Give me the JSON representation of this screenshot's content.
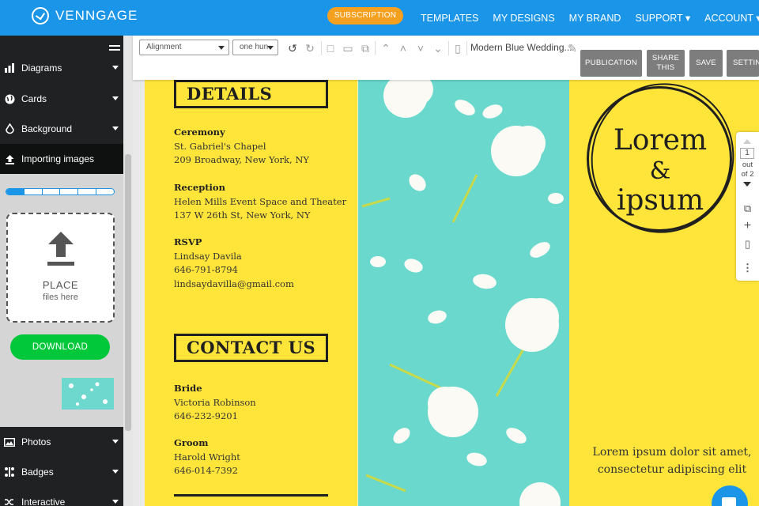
{
  "brand": {
    "name": "VENNGAGE"
  },
  "topnav": {
    "subscription": "SUBSCRIPTION",
    "links": [
      "TEMPLATES",
      "MY DESIGNS",
      "MY BRAND",
      "SUPPORT ▾",
      "ACCOUNT ▾"
    ]
  },
  "sidebar": {
    "items": [
      {
        "label": "Diagrams",
        "icon": "bar-chart-icon"
      },
      {
        "label": "Cards",
        "icon": "globe-icon"
      },
      {
        "label": "Background",
        "icon": "drop-icon"
      },
      {
        "label": "Importing images",
        "icon": "upload-icon"
      },
      {
        "label": "Photos",
        "icon": "image-icon"
      },
      {
        "label": "Badges",
        "icon": "badge-icon"
      },
      {
        "label": "Interactive",
        "icon": "shuffle-icon"
      }
    ],
    "upload": {
      "title": "PLACE",
      "subtitle": "files here"
    },
    "upload_progress_segments_filled": 1,
    "upload_progress_segments_total": 6,
    "download": "DOWNLOAD"
  },
  "toolbar": {
    "alignment": "Alignment",
    "size": "one hun",
    "doc_title": "Modern Blue Wedding...",
    "buttons": {
      "publication": "PUBLICATION",
      "share": "SHARE THIS",
      "save": "SAVE",
      "settings": "SETTIN"
    }
  },
  "flyer": {
    "details_title": "DETAILS",
    "ceremony": {
      "label": "Ceremony",
      "line1": "St. Gabriel's Chapel",
      "line2": "209 Broadway, New York, NY"
    },
    "reception": {
      "label": "Reception",
      "line1": "Helen Mills Event Space and Theater",
      "line2": "137 W 26th St, New York, NY"
    },
    "rsvp": {
      "label": "RSVP",
      "line1": "Lindsay Davila",
      "line2": "646-791-8794",
      "line3": "lindsaydavilla@gmail.com"
    },
    "contact_title": "CONTACT US",
    "bride": {
      "label": "Bride",
      "name": "Victoria Robinson",
      "phone": "646-232-9201"
    },
    "groom": {
      "label": "Groom",
      "name": "Harold Wright",
      "phone": "646-014-7392"
    },
    "lorem1": "Lorem",
    "lorem2": "&",
    "lorem3": "ipsum",
    "lorem_body1": "Lorem ipsum dolor sit amet,",
    "lorem_body2": "consectetur adipiscing elit"
  },
  "pagenav": {
    "current": "1",
    "out": "out",
    "of": "of 2"
  },
  "colors": {
    "brand_blue": "#1b95e8",
    "flyer_yellow": "#ffe53a",
    "teal": "#6ad8cd",
    "download_green": "#00c83a",
    "subscription_orange": "#f6a01f"
  }
}
